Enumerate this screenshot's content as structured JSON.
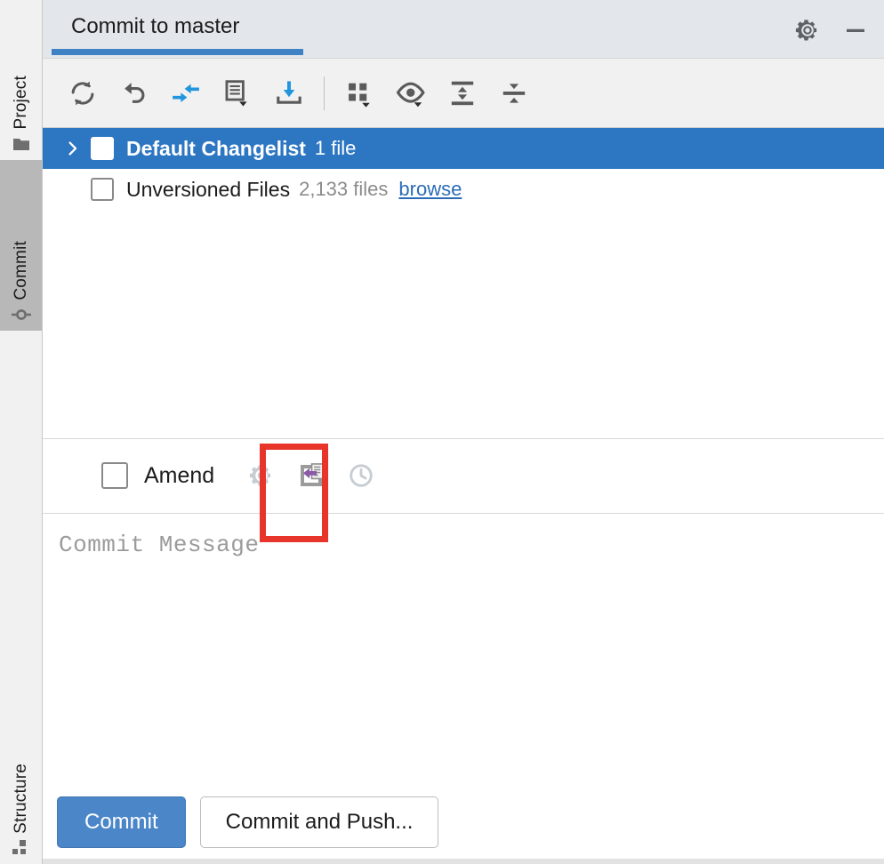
{
  "sidebar": {
    "items": [
      {
        "label": "Project",
        "icon": "folder-icon",
        "selected": false
      },
      {
        "label": "Commit",
        "icon": "commit-node-icon",
        "selected": true
      },
      {
        "label": "Structure",
        "icon": "structure-icon",
        "selected": false
      }
    ]
  },
  "header": {
    "tab_title": "Commit to master",
    "settings_icon": "gear-icon",
    "minimize_icon": "minimize-icon"
  },
  "toolbar": {
    "buttons": [
      {
        "name": "refresh-changes-button",
        "icon": "refresh-icon",
        "tooltip": "Refresh Changes"
      },
      {
        "name": "rollback-button",
        "icon": "rollback-undo-icon",
        "tooltip": "Rollback"
      },
      {
        "name": "show-diff-button",
        "icon": "show-diff-icon",
        "tooltip": "Show Diff"
      },
      {
        "name": "move-to-changelist-button",
        "icon": "changelist-icon",
        "tooltip": "Move to Another Changelist"
      },
      {
        "name": "shelve-changes-button",
        "icon": "shelve-icon",
        "tooltip": "Shelve Silently"
      },
      {
        "name": "group-by-button",
        "icon": "group-by-icon",
        "tooltip": "Group By"
      },
      {
        "name": "preview-diff-button",
        "icon": "eye-icon",
        "tooltip": "Preview Diff"
      },
      {
        "name": "expand-all-button",
        "icon": "expand-all-icon",
        "tooltip": "Expand All"
      },
      {
        "name": "collapse-all-button",
        "icon": "collapse-all-icon",
        "tooltip": "Collapse All"
      }
    ]
  },
  "changes": {
    "rows": [
      {
        "name": "Default Changelist",
        "count": "1 file",
        "link": "",
        "selected": true,
        "expandable": true,
        "checked": false,
        "bold": true
      },
      {
        "name": "Unversioned Files",
        "count": "2,133 files",
        "link": "browse",
        "selected": false,
        "expandable": false,
        "checked": false,
        "bold": false
      }
    ]
  },
  "amend": {
    "checkbox_label": "Amend",
    "checked": false,
    "actions": [
      {
        "name": "commit-options-button",
        "icon": "gear-icon",
        "enabled": false
      },
      {
        "name": "commit-message-history-button",
        "icon": "message-history-icon",
        "enabled": true,
        "highlighted": true
      },
      {
        "name": "recent-messages-button",
        "icon": "clock-icon",
        "enabled": false
      }
    ]
  },
  "message": {
    "placeholder": "Commit Message",
    "value": ""
  },
  "actions": {
    "commit_label": "Commit",
    "commit_and_push_label": "Commit and Push..."
  },
  "colors": {
    "selection_blue": "#2c76c2",
    "tab_underline": "#3e82c4",
    "primary_button": "#4a86c8",
    "link": "#2b6cb8",
    "highlight_red": "#e8352b",
    "accent_icon_blue": "#2196dd",
    "icon_gray": "#5a5a5a",
    "disabled_gray": "#c6cdd2",
    "purple_arrow": "#8c5aa8"
  }
}
